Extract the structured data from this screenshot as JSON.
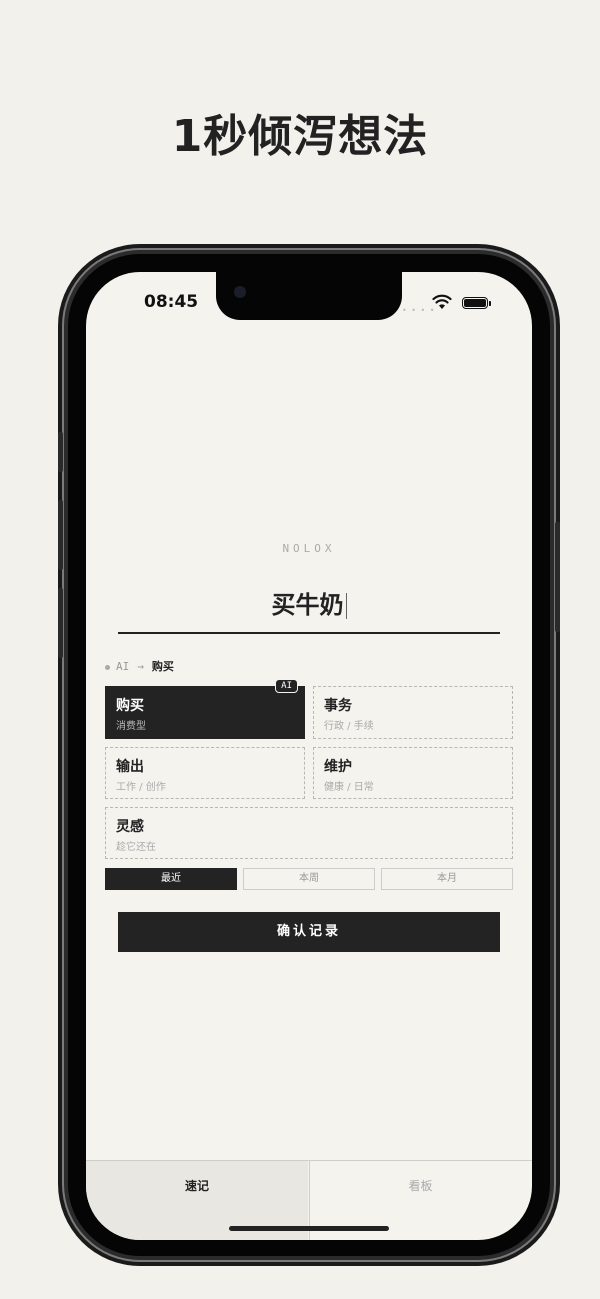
{
  "headline": "1秒倾泻想法",
  "status_bar": {
    "time": "08:45"
  },
  "brand": "NOLOX",
  "input": {
    "value": "买牛奶"
  },
  "ai_route": {
    "source": "AI",
    "target": "购买"
  },
  "categories": [
    {
      "name": "购买",
      "sub": "消费型",
      "selected": true,
      "badge": "AI"
    },
    {
      "name": "事务",
      "sub": "行政 / 手续",
      "selected": false
    },
    {
      "name": "输出",
      "sub": "工作 / 创作",
      "selected": false
    },
    {
      "name": "维护",
      "sub": "健康 / 日常",
      "selected": false
    },
    {
      "name": "灵感",
      "sub": "趁它还在",
      "selected": false
    }
  ],
  "time_ranges": [
    {
      "label": "最近",
      "selected": true
    },
    {
      "label": "本周",
      "selected": false
    },
    {
      "label": "本月",
      "selected": false
    }
  ],
  "confirm_button": "确认记录",
  "tabs": [
    {
      "label": "速记",
      "selected": true
    },
    {
      "label": "看板",
      "selected": false
    }
  ],
  "colors": {
    "background": "#f2f1ec",
    "accent": "#232323",
    "muted": "#aaaaaa"
  }
}
